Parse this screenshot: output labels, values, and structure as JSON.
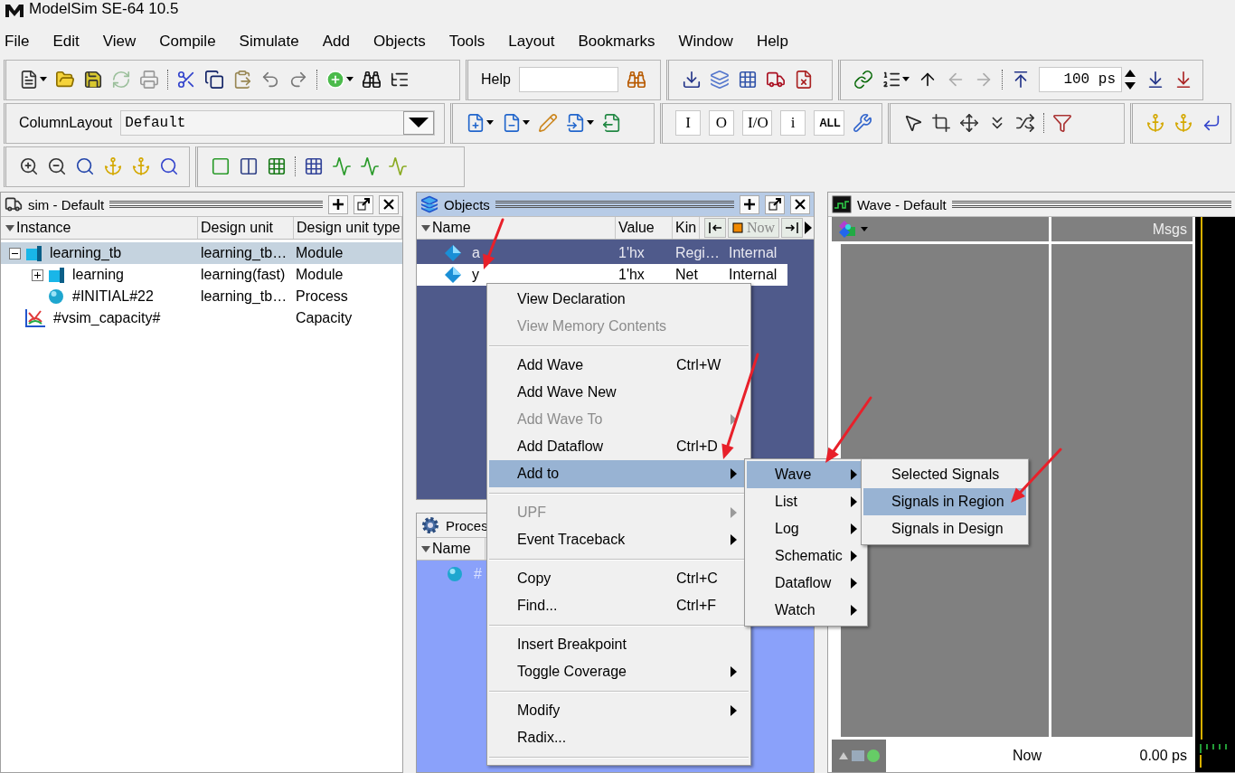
{
  "window": {
    "title": "ModelSim SE-64 10.5"
  },
  "menu_bar": [
    "File",
    "Edit",
    "View",
    "Compile",
    "Simulate",
    "Add",
    "Objects",
    "Tools",
    "Layout",
    "Bookmarks",
    "Window",
    "Help"
  ],
  "toolbar": {
    "help_label": "Help",
    "column_layout_label": "ColumnLayout",
    "column_layout_value": "Default",
    "run_length": "100 ps",
    "filter_buttons": [
      "I",
      "O",
      "I/O",
      "i",
      "ALL"
    ]
  },
  "sim_pane": {
    "title": "sim - Default",
    "active": false,
    "columns": [
      "Instance",
      "Design unit",
      "Design unit type"
    ],
    "rows": [
      {
        "name": "learning_tb",
        "unit": "learning_tb…",
        "type": "Module",
        "kind": "module",
        "expanded": true,
        "selected": true,
        "children": [
          {
            "name": "learning",
            "unit": "learning(fast)",
            "type": "Module",
            "kind": "module",
            "expanded": false,
            "selected": false
          },
          {
            "name": "#INITIAL#22",
            "unit": "learning_tb…",
            "type": "Process",
            "kind": "process",
            "selected": false
          }
        ]
      },
      {
        "name": "#vsim_capacity#",
        "type": "Capacity",
        "kind": "capacity",
        "selected": false
      }
    ]
  },
  "objects_pane": {
    "title": "Objects",
    "active": true,
    "columns": [
      "Name",
      "Value",
      "Kin"
    ],
    "now_button": "Now",
    "rows": [
      {
        "name": "a",
        "value": "1'hx",
        "type_value": "Regi…",
        "mode": "Internal",
        "selected": false
      },
      {
        "name": "y",
        "value": "1'hx",
        "type_value": "Net",
        "mode": "Internal",
        "selected": true
      }
    ]
  },
  "processes_pane": {
    "title": "Proces",
    "active": false,
    "columns": [
      "Name"
    ],
    "rows": [
      {
        "name": "#"
      }
    ]
  },
  "wave_pane": {
    "title": "Wave - Default",
    "active": false,
    "columns": [
      "Msgs"
    ],
    "footer": {
      "label": "Now",
      "time": "0.00 ps"
    }
  },
  "context_menu": {
    "items": [
      {
        "kind": "item",
        "label": "View Declaration",
        "disabled": false,
        "submenu": false,
        "selected": false
      },
      {
        "kind": "item",
        "label": "View Memory Contents",
        "disabled": true,
        "submenu": false,
        "selected": false
      },
      {
        "kind": "separator"
      },
      {
        "kind": "item",
        "label": "Add Wave",
        "shortcut": "Ctrl+W",
        "disabled": false,
        "submenu": false,
        "selected": false
      },
      {
        "kind": "item",
        "label": "Add Wave New",
        "disabled": false,
        "submenu": false,
        "selected": false
      },
      {
        "kind": "item",
        "label": "Add Wave To",
        "disabled": true,
        "submenu": true,
        "selected": false
      },
      {
        "kind": "item",
        "label": "Add Dataflow",
        "shortcut": "Ctrl+D",
        "disabled": false,
        "submenu": false,
        "selected": false
      },
      {
        "kind": "item",
        "label": "Add to",
        "disabled": false,
        "submenu": true,
        "selected": true
      },
      {
        "kind": "separator"
      },
      {
        "kind": "item",
        "label": "UPF",
        "disabled": true,
        "submenu": true,
        "selected": false
      },
      {
        "kind": "item",
        "label": "Event Traceback",
        "disabled": false,
        "submenu": true,
        "selected": false
      },
      {
        "kind": "separator"
      },
      {
        "kind": "item",
        "label": "Copy",
        "shortcut": "Ctrl+C",
        "disabled": false,
        "submenu": false,
        "selected": false
      },
      {
        "kind": "item",
        "label": "Find...",
        "shortcut": "Ctrl+F",
        "disabled": false,
        "submenu": false,
        "selected": false
      },
      {
        "kind": "separator"
      },
      {
        "kind": "item",
        "label": "Insert Breakpoint",
        "disabled": false,
        "submenu": false,
        "selected": false
      },
      {
        "kind": "item",
        "label": "Toggle Coverage",
        "disabled": false,
        "submenu": true,
        "selected": false
      },
      {
        "kind": "separator"
      },
      {
        "kind": "item",
        "label": "Modify",
        "disabled": false,
        "submenu": true,
        "selected": false
      },
      {
        "kind": "item",
        "label": "Radix...",
        "disabled": false,
        "submenu": false,
        "selected": false
      },
      {
        "kind": "separator"
      }
    ]
  },
  "add_to_submenu": {
    "items": [
      {
        "kind": "item",
        "label": "Wave",
        "disabled": false,
        "submenu": true,
        "selected": true
      },
      {
        "kind": "item",
        "label": "List",
        "disabled": false,
        "submenu": true,
        "selected": false
      },
      {
        "kind": "item",
        "label": "Log",
        "disabled": false,
        "submenu": true,
        "selected": false
      },
      {
        "kind": "item",
        "label": "Schematic",
        "disabled": false,
        "submenu": true,
        "selected": false
      },
      {
        "kind": "item",
        "label": "Dataflow",
        "disabled": false,
        "submenu": true,
        "selected": false
      },
      {
        "kind": "item",
        "label": "Watch",
        "disabled": false,
        "submenu": true,
        "selected": false
      }
    ]
  },
  "wave_submenu": {
    "items": [
      {
        "kind": "item",
        "label": "Selected Signals",
        "disabled": false,
        "submenu": false,
        "selected": false
      },
      {
        "kind": "item",
        "label": "Signals in Region",
        "disabled": false,
        "submenu": false,
        "selected": true
      },
      {
        "kind": "item",
        "label": "Signals in Design",
        "disabled": false,
        "submenu": false,
        "selected": false
      }
    ]
  }
}
